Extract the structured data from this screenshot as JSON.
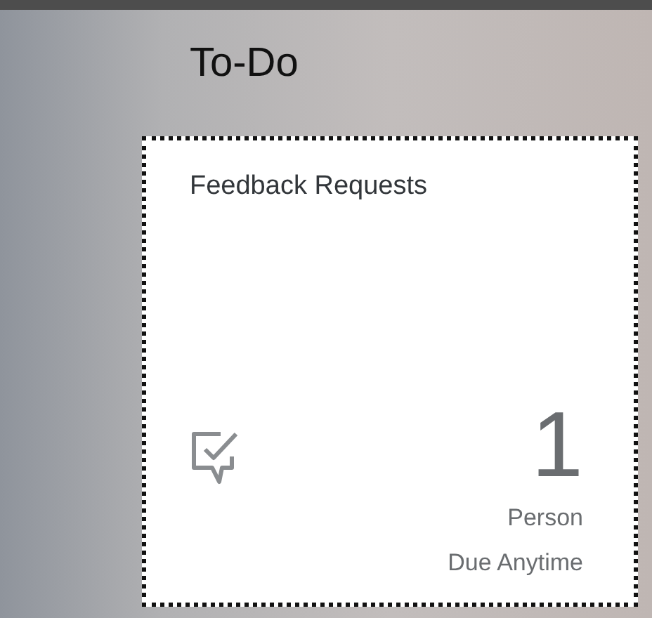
{
  "section": {
    "title": "To-Do"
  },
  "tile": {
    "title": "Feedback Requests",
    "focused": true,
    "number": "1",
    "unit": "Person",
    "footer": "Due Anytime"
  }
}
